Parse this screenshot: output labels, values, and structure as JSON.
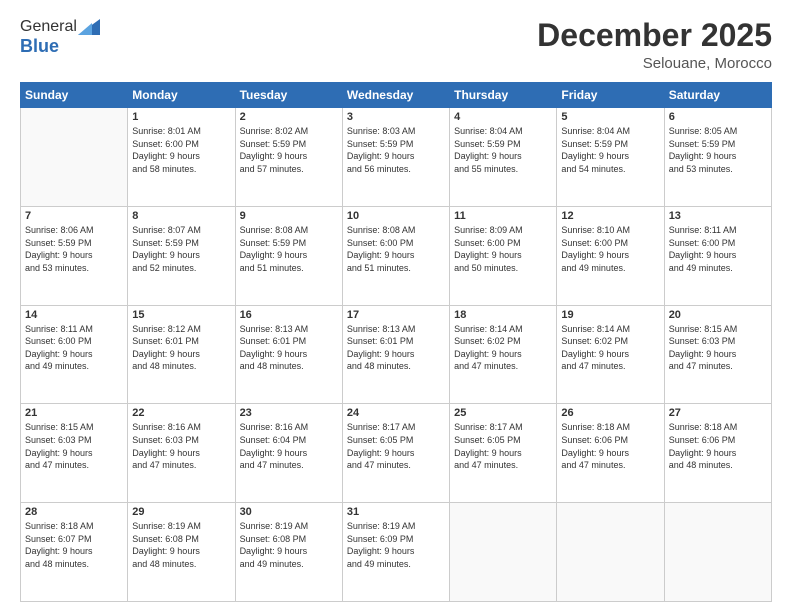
{
  "logo": {
    "general": "General",
    "blue": "Blue"
  },
  "title": "December 2025",
  "location": "Selouane, Morocco",
  "days_header": [
    "Sunday",
    "Monday",
    "Tuesday",
    "Wednesday",
    "Thursday",
    "Friday",
    "Saturday"
  ],
  "weeks": [
    [
      {
        "day": "",
        "info": ""
      },
      {
        "day": "1",
        "info": "Sunrise: 8:01 AM\nSunset: 6:00 PM\nDaylight: 9 hours\nand 58 minutes."
      },
      {
        "day": "2",
        "info": "Sunrise: 8:02 AM\nSunset: 5:59 PM\nDaylight: 9 hours\nand 57 minutes."
      },
      {
        "day": "3",
        "info": "Sunrise: 8:03 AM\nSunset: 5:59 PM\nDaylight: 9 hours\nand 56 minutes."
      },
      {
        "day": "4",
        "info": "Sunrise: 8:04 AM\nSunset: 5:59 PM\nDaylight: 9 hours\nand 55 minutes."
      },
      {
        "day": "5",
        "info": "Sunrise: 8:04 AM\nSunset: 5:59 PM\nDaylight: 9 hours\nand 54 minutes."
      },
      {
        "day": "6",
        "info": "Sunrise: 8:05 AM\nSunset: 5:59 PM\nDaylight: 9 hours\nand 53 minutes."
      }
    ],
    [
      {
        "day": "7",
        "info": "Sunrise: 8:06 AM\nSunset: 5:59 PM\nDaylight: 9 hours\nand 53 minutes."
      },
      {
        "day": "8",
        "info": "Sunrise: 8:07 AM\nSunset: 5:59 PM\nDaylight: 9 hours\nand 52 minutes."
      },
      {
        "day": "9",
        "info": "Sunrise: 8:08 AM\nSunset: 5:59 PM\nDaylight: 9 hours\nand 51 minutes."
      },
      {
        "day": "10",
        "info": "Sunrise: 8:08 AM\nSunset: 6:00 PM\nDaylight: 9 hours\nand 51 minutes."
      },
      {
        "day": "11",
        "info": "Sunrise: 8:09 AM\nSunset: 6:00 PM\nDaylight: 9 hours\nand 50 minutes."
      },
      {
        "day": "12",
        "info": "Sunrise: 8:10 AM\nSunset: 6:00 PM\nDaylight: 9 hours\nand 49 minutes."
      },
      {
        "day": "13",
        "info": "Sunrise: 8:11 AM\nSunset: 6:00 PM\nDaylight: 9 hours\nand 49 minutes."
      }
    ],
    [
      {
        "day": "14",
        "info": "Sunrise: 8:11 AM\nSunset: 6:00 PM\nDaylight: 9 hours\nand 49 minutes."
      },
      {
        "day": "15",
        "info": "Sunrise: 8:12 AM\nSunset: 6:01 PM\nDaylight: 9 hours\nand 48 minutes."
      },
      {
        "day": "16",
        "info": "Sunrise: 8:13 AM\nSunset: 6:01 PM\nDaylight: 9 hours\nand 48 minutes."
      },
      {
        "day": "17",
        "info": "Sunrise: 8:13 AM\nSunset: 6:01 PM\nDaylight: 9 hours\nand 48 minutes."
      },
      {
        "day": "18",
        "info": "Sunrise: 8:14 AM\nSunset: 6:02 PM\nDaylight: 9 hours\nand 47 minutes."
      },
      {
        "day": "19",
        "info": "Sunrise: 8:14 AM\nSunset: 6:02 PM\nDaylight: 9 hours\nand 47 minutes."
      },
      {
        "day": "20",
        "info": "Sunrise: 8:15 AM\nSunset: 6:03 PM\nDaylight: 9 hours\nand 47 minutes."
      }
    ],
    [
      {
        "day": "21",
        "info": "Sunrise: 8:15 AM\nSunset: 6:03 PM\nDaylight: 9 hours\nand 47 minutes."
      },
      {
        "day": "22",
        "info": "Sunrise: 8:16 AM\nSunset: 6:03 PM\nDaylight: 9 hours\nand 47 minutes."
      },
      {
        "day": "23",
        "info": "Sunrise: 8:16 AM\nSunset: 6:04 PM\nDaylight: 9 hours\nand 47 minutes."
      },
      {
        "day": "24",
        "info": "Sunrise: 8:17 AM\nSunset: 6:05 PM\nDaylight: 9 hours\nand 47 minutes."
      },
      {
        "day": "25",
        "info": "Sunrise: 8:17 AM\nSunset: 6:05 PM\nDaylight: 9 hours\nand 47 minutes."
      },
      {
        "day": "26",
        "info": "Sunrise: 8:18 AM\nSunset: 6:06 PM\nDaylight: 9 hours\nand 47 minutes."
      },
      {
        "day": "27",
        "info": "Sunrise: 8:18 AM\nSunset: 6:06 PM\nDaylight: 9 hours\nand 48 minutes."
      }
    ],
    [
      {
        "day": "28",
        "info": "Sunrise: 8:18 AM\nSunset: 6:07 PM\nDaylight: 9 hours\nand 48 minutes."
      },
      {
        "day": "29",
        "info": "Sunrise: 8:19 AM\nSunset: 6:08 PM\nDaylight: 9 hours\nand 48 minutes."
      },
      {
        "day": "30",
        "info": "Sunrise: 8:19 AM\nSunset: 6:08 PM\nDaylight: 9 hours\nand 49 minutes."
      },
      {
        "day": "31",
        "info": "Sunrise: 8:19 AM\nSunset: 6:09 PM\nDaylight: 9 hours\nand 49 minutes."
      },
      {
        "day": "",
        "info": ""
      },
      {
        "day": "",
        "info": ""
      },
      {
        "day": "",
        "info": ""
      }
    ]
  ]
}
